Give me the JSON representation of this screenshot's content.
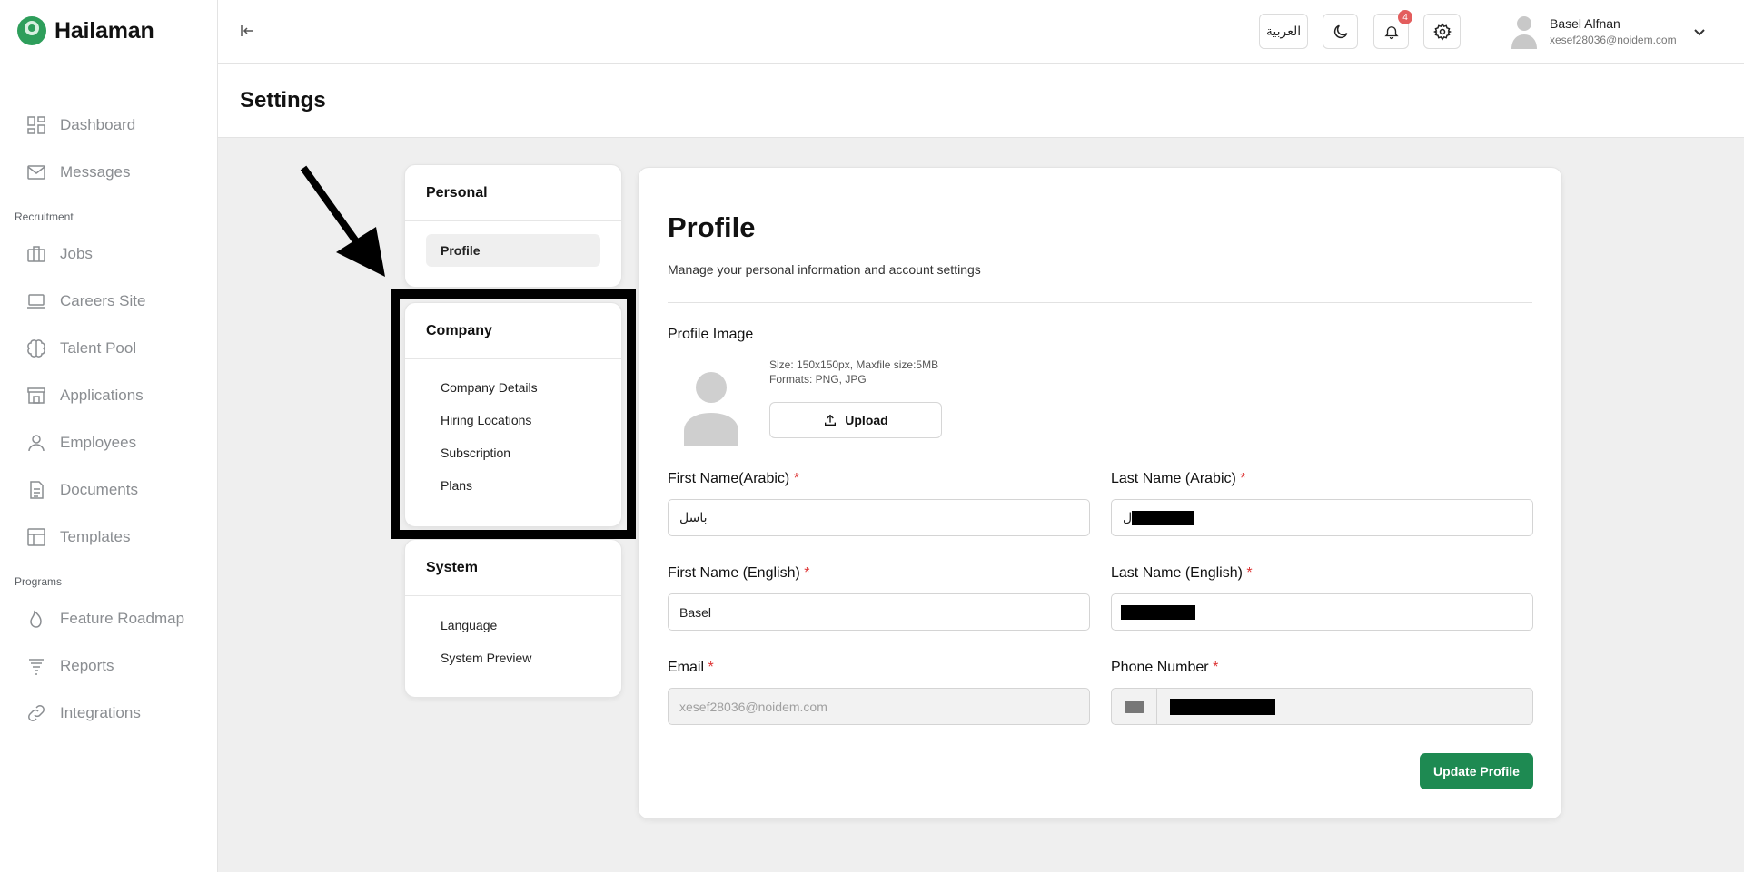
{
  "app": {
    "name": "Hailaman"
  },
  "sidebar": {
    "items_main": [
      {
        "label": "Dashboard",
        "icon": "dashboard-icon"
      },
      {
        "label": "Messages",
        "icon": "mail-icon"
      }
    ],
    "section_recruitment": "Recruitment",
    "items_recruitment": [
      {
        "label": "Jobs",
        "icon": "briefcase-icon"
      },
      {
        "label": "Careers Site",
        "icon": "laptop-icon"
      },
      {
        "label": "Talent Pool",
        "icon": "brain-icon"
      },
      {
        "label": "Applications",
        "icon": "store-icon"
      },
      {
        "label": "Employees",
        "icon": "user-icon"
      },
      {
        "label": "Documents",
        "icon": "document-icon"
      },
      {
        "label": "Templates",
        "icon": "template-icon"
      }
    ],
    "section_programs": "Programs",
    "items_programs": [
      {
        "label": "Feature Roadmap",
        "icon": "flame-icon"
      },
      {
        "label": "Reports",
        "icon": "filter-lines-icon"
      },
      {
        "label": "Integrations",
        "icon": "link-icon"
      }
    ]
  },
  "topbar": {
    "language_label": "العربية",
    "notification_count": "4",
    "user": {
      "name": "Basel Alfnan",
      "email": "xesef28036@noidem.com"
    }
  },
  "page": {
    "title": "Settings"
  },
  "settings_nav": {
    "personal": {
      "title": "Personal",
      "items": [
        "Profile"
      ],
      "active": "Profile"
    },
    "company": {
      "title": "Company",
      "items": [
        "Company Details",
        "Hiring Locations",
        "Subscription",
        "Plans"
      ]
    },
    "system": {
      "title": "System",
      "items": [
        "Language",
        "System Preview"
      ]
    }
  },
  "profile": {
    "title": "Profile",
    "subtitle": "Manage your personal information and account settings",
    "image_label": "Profile Image",
    "image_hint_size": "Size: 150x150px, Maxfile size:5MB",
    "image_hint_formats": "Formats: PNG, JPG",
    "upload_label": "Upload",
    "first_name_ar_label": "First Name(Arabic)",
    "first_name_ar_value": "باسل",
    "last_name_ar_label": "Last Name (Arabic)",
    "last_name_ar_value": "ل",
    "first_name_en_label": "First Name (English)",
    "first_name_en_value": "Basel",
    "last_name_en_label": "Last Name (English)",
    "email_label": "Email",
    "email_value": "xesef28036@noidem.com",
    "phone_label": "Phone Number",
    "required_mark": "*",
    "update_label": "Update Profile"
  },
  "colors": {
    "brand_green": "#2e9e5b",
    "button_green": "#1e8a52",
    "badge_red": "#e35d5d"
  }
}
